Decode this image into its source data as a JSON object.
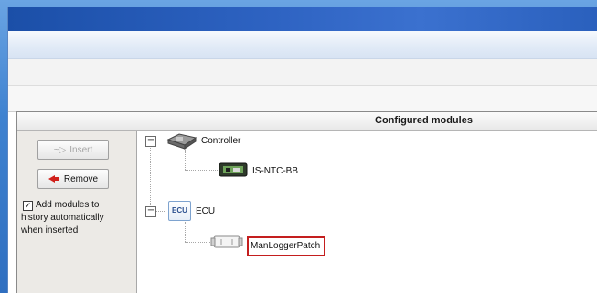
{
  "window": {
    "title": ""
  },
  "panel": {
    "title": "Configured modules"
  },
  "sidebar": {
    "insert_label": "Insert",
    "insert_glyph": "~▷",
    "remove_label": "Remove",
    "checkbox": {
      "checked": true,
      "label_line1": "Add modules to",
      "label_line2": "history automatically",
      "label_line3": "when inserted"
    }
  },
  "tree": {
    "controller": {
      "label": "Controller",
      "icon": "controller-board-icon",
      "toggle": "−"
    },
    "is_ntc": {
      "label": "IS-NTC-BB",
      "icon": "ntc-board-icon"
    },
    "ecu": {
      "label": "ECU",
      "icon_text": "ECU",
      "toggle": "−"
    },
    "manlogger": {
      "label": "ManLoggerPatch",
      "icon": "patch-module-icon",
      "highlight_color": "#c41e1e"
    }
  },
  "colors": {
    "desktop": "#3f82d0",
    "highlight": "#c41e1e",
    "remove_arrow": "#d0201a"
  }
}
